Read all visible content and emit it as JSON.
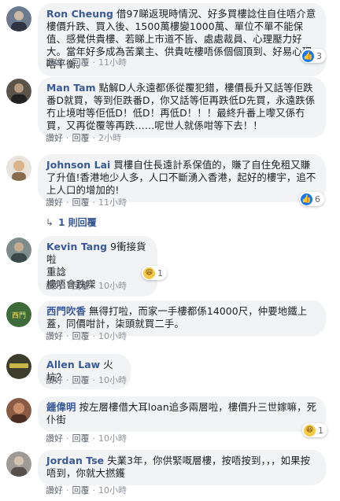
{
  "ui": {
    "like": "讚好",
    "reply": "回覆",
    "separator": "·"
  },
  "comments": [
    {
      "author": "Ron Cheung",
      "text": "借97睇返現時情況、好多買樓諗住自住唔介意樓價升跌、買入後、1500萬樓變1000萬、單位不單不能保值、感覺供貴樓、若睇上市道不皆、處處裁員、心理壓力好大。當年好多成為苦業主、供貴咗樓唔係個個頂到、好易心理唔平衡。",
      "time": "11小時",
      "reaction": {
        "icon": "like-icon",
        "count": "3"
      },
      "avatar_color": "#6b7a8f"
    },
    {
      "author": "Man Tam",
      "text": "點解D人永遠都係從覆犯錯，樓價長升又話等佢跌番D就買，等到佢跌番D，你又話等佢再跌低D先買，永遠跌係冇止境咁等佢低D！低D！再低D！！！最終升番上嚟又係冇買，又再從覆等再跌……呢世人就係咁等下去！！",
      "time": "2小時",
      "reaction": null,
      "avatar_color": "#5a5448"
    },
    {
      "author": "Johnson Lai",
      "text": "買樓自住長遠計系保值的，賺了自住免租又賺了升值!香港地少人多，人口不斷湧入香港，起好的樓宇，追不上人口的增加的!",
      "time": "11小時",
      "reaction": {
        "icon": "like-icon",
        "count": "6"
      },
      "replies": "1 則回覆",
      "avatar_color": "#d9b38c"
    },
    {
      "author": "Kevin Tang",
      "text": "9衝接貨啦\n重諗\n樓唔會跌㗎",
      "time": "10小時",
      "reaction": {
        "icon": "haha-icon",
        "count": "1"
      },
      "avatar_color": "#7d8c8a"
    },
    {
      "author": "西門吹香",
      "text": "無得打啦，而家一手樓都係14000尺，仲要地鐵上蓋，同價咁計，柒頭就買二手。",
      "time": "10小時",
      "reaction": null,
      "avatar_color": "#3f6b3a"
    },
    {
      "author": "Allen Law",
      "text": "火坑？",
      "time": "10小時",
      "reaction": null,
      "avatar_color": "#3d3d2e"
    },
    {
      "author": "鍾偉明",
      "text": "按左層樓借大耳loan追多兩層啦，樓價升三世嫁嘛，死仆街",
      "time": "10小時",
      "reaction": {
        "icon": "haha-icon",
        "count": "1"
      },
      "avatar_color": "#8a5a44"
    },
    {
      "author": "Jordan Tse",
      "text": "失業3年，你供緊嘅層樓，按唔按到，，，如果按唔到，你就大撚鑊",
      "time": "10小時",
      "reaction": null,
      "avatar_color": "#a09a94"
    }
  ]
}
